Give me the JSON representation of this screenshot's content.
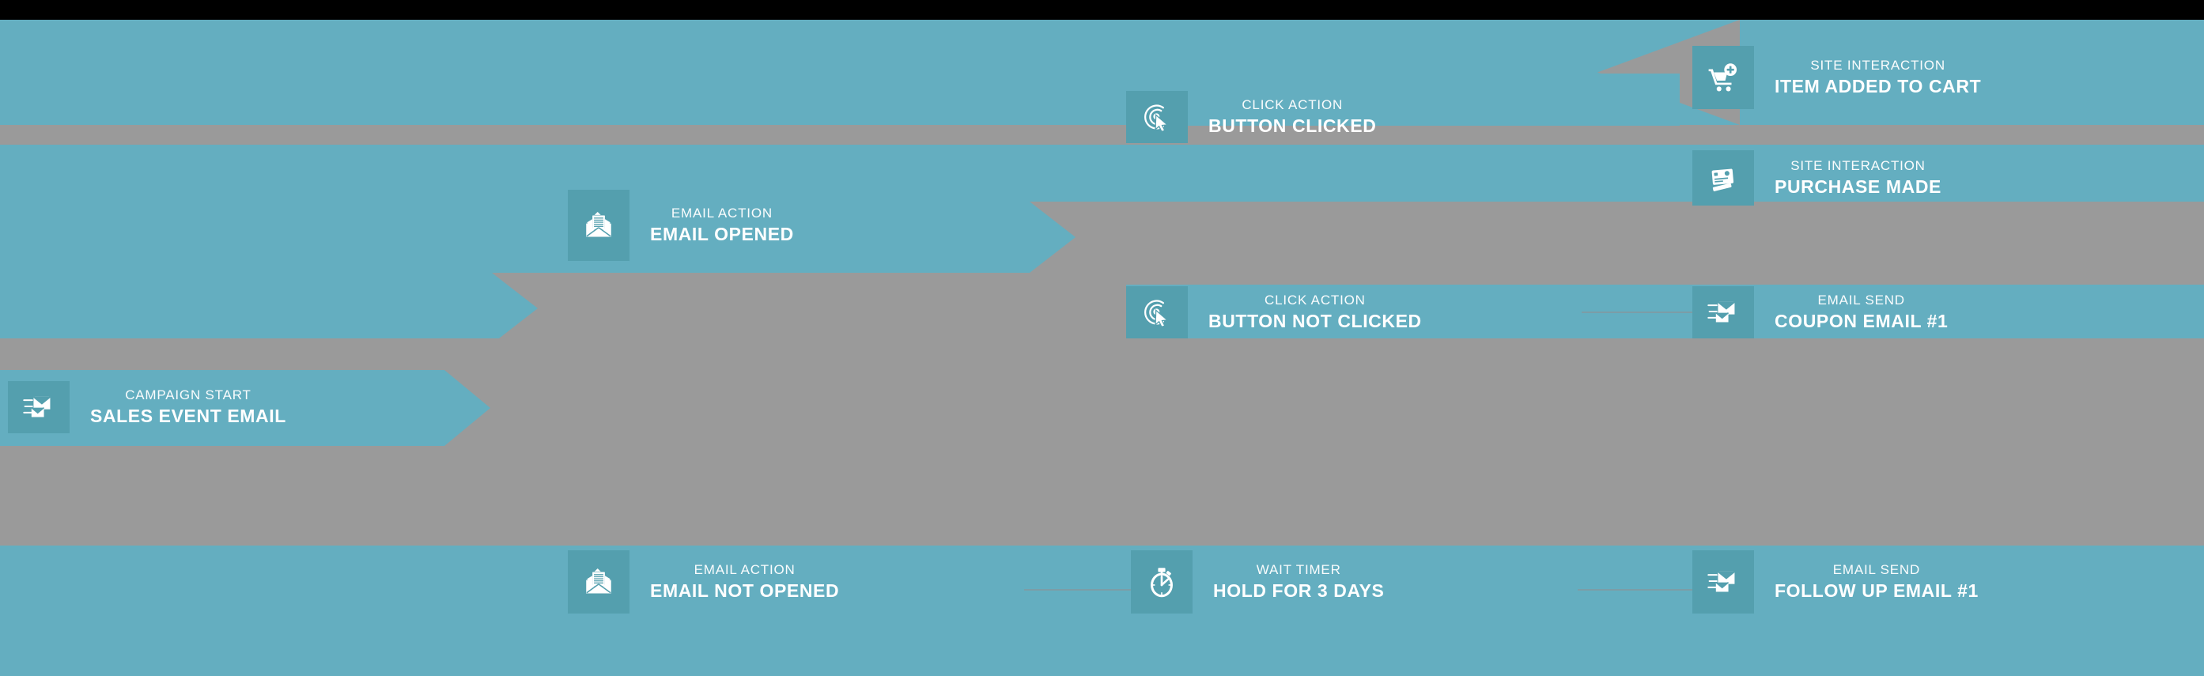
{
  "diagram": {
    "title": "Email Campaign Automation Flow",
    "colors": {
      "teal": "#64aec0",
      "teal_dark": "#549fae",
      "gray": "#9a9a9a",
      "black": "#000000",
      "text": "#ffffff"
    }
  },
  "nodes": [
    {
      "id": "campaign-start",
      "kicker": "CAMPAIGN START",
      "title": "SALES EVENT EMAIL",
      "icon": "email-send-icon"
    },
    {
      "id": "email-opened",
      "kicker": "EMAIL ACTION",
      "title": "EMAIL OPENED",
      "icon": "email-opened-icon"
    },
    {
      "id": "button-clicked",
      "kicker": "CLICK ACTION",
      "title": "BUTTON CLICKED",
      "icon": "click-target-icon"
    },
    {
      "id": "item-added-to-cart",
      "kicker": "SITE INTERACTION",
      "title": "ITEM ADDED TO CART",
      "icon": "cart-add-icon"
    },
    {
      "id": "purchase-made",
      "kicker": "SITE INTERACTION",
      "title": "PURCHASE MADE",
      "icon": "credit-cards-icon"
    },
    {
      "id": "button-not-clicked",
      "kicker": "CLICK ACTION",
      "title": "BUTTON NOT CLICKED",
      "icon": "click-target-icon"
    },
    {
      "id": "coupon-email",
      "kicker": "EMAIL SEND",
      "title": "COUPON EMAIL #1",
      "icon": "email-send-icon"
    },
    {
      "id": "email-not-opened",
      "kicker": "EMAIL ACTION",
      "title": "EMAIL NOT OPENED",
      "icon": "email-opened-icon"
    },
    {
      "id": "wait-timer",
      "kicker": "WAIT TIMER",
      "title": "HOLD FOR  3 DAYS",
      "icon": "stopwatch-icon"
    },
    {
      "id": "follow-up-email",
      "kicker": "EMAIL SEND",
      "title": "FOLLOW UP EMAIL #1",
      "icon": "email-send-icon"
    }
  ]
}
